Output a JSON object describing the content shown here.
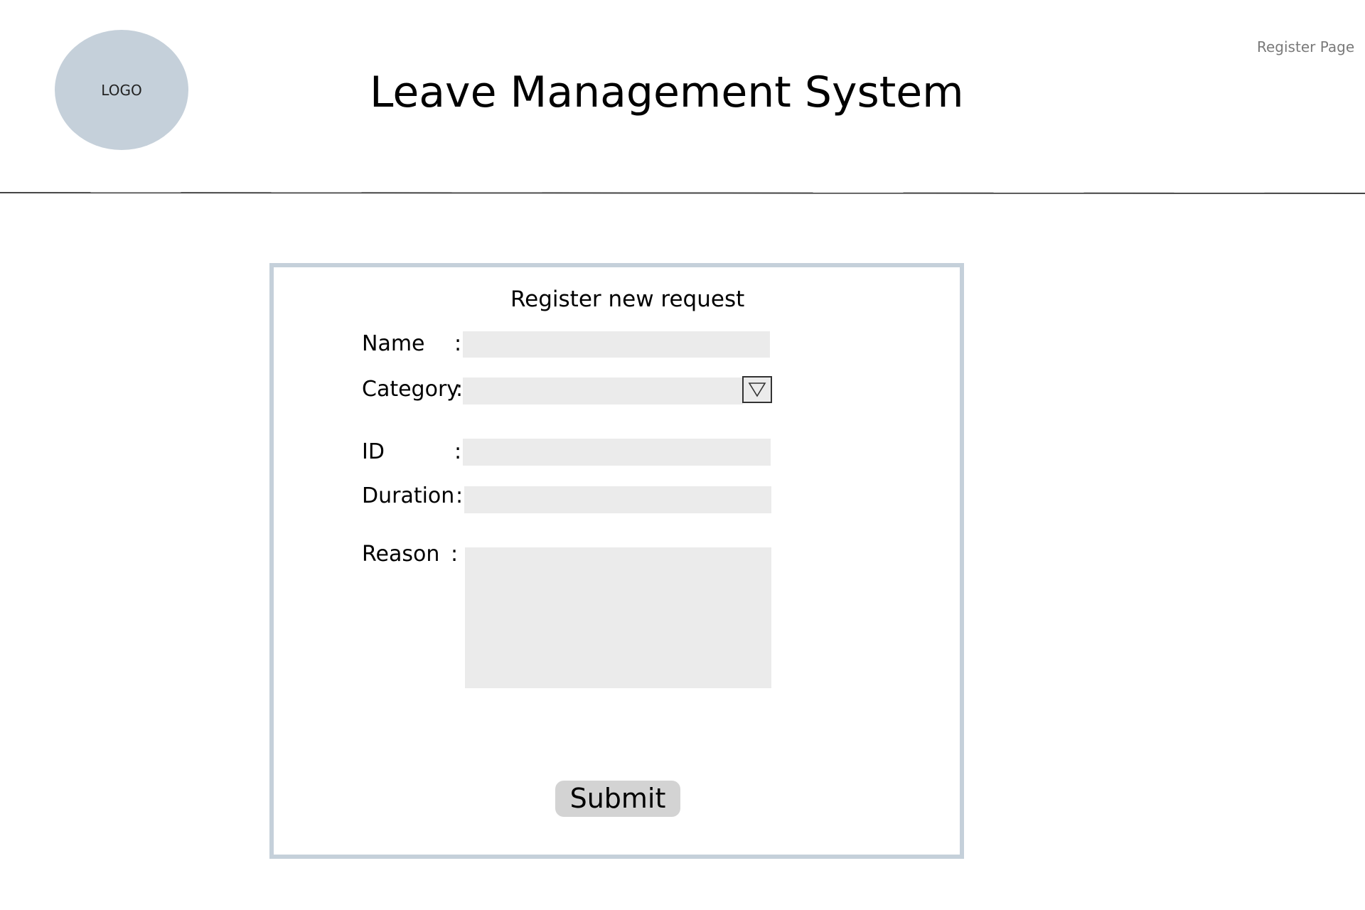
{
  "header": {
    "logo_text": "LOGO",
    "title": "Leave Management System",
    "page_label": "Register Page"
  },
  "form": {
    "heading": "Register new request",
    "separator": ":",
    "fields": {
      "name": {
        "label": "Name",
        "value": ""
      },
      "category": {
        "label": "Category",
        "value": ""
      },
      "id": {
        "label": "ID",
        "value": ""
      },
      "duration": {
        "label": "Duration",
        "value": ""
      },
      "reason": {
        "label": "Reason",
        "value": ""
      }
    },
    "submit_label": "Submit"
  },
  "icons": {
    "dropdown": "triangle-down-icon"
  },
  "colors": {
    "logo_fill": "#c5d0da",
    "form_border": "#c5d0da",
    "input_fill": "#ebebeb",
    "button_fill": "#d3d3d3",
    "page_label": "#7a7a7a"
  }
}
